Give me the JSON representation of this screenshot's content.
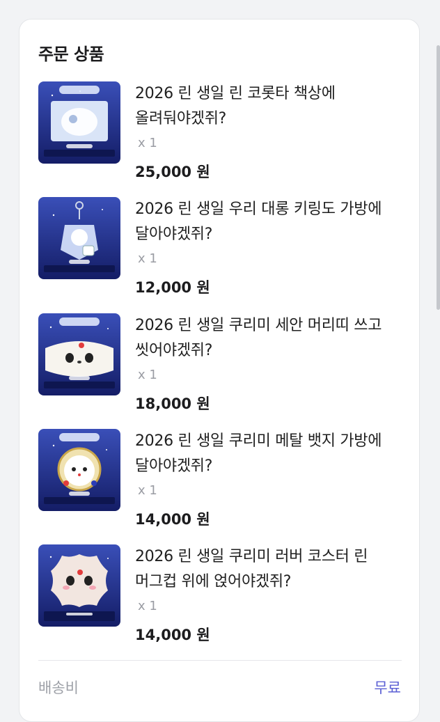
{
  "section": {
    "title": "주문 상품"
  },
  "items": [
    {
      "title_line1": "2026 린 생일 린 코롯타 책상에",
      "title_line2": "올려둬야겠쥐?",
      "qty": "x 1",
      "price": "25,000 원",
      "thumb_caption": "린 코롯타 책상에 올려둬야겠쥐"
    },
    {
      "title_line1": "2026 린 생일 우리 대롱 키링도 가방에",
      "title_line2": "달아야겠쥐?",
      "qty": "x 1",
      "price": "12,000 원",
      "thumb_caption": "우리 대롱 키링도 가방에 달아야겠쥐"
    },
    {
      "title_line1": "2026 린 생일 쿠리미 세안 머리띠 쓰고",
      "title_line2": "씻어야겠쥐?",
      "qty": "x 1",
      "price": "18,000 원",
      "thumb_caption": "쿠리미 세안 머리띠 쓰고 씻어야겠쥐"
    },
    {
      "title_line1": "2026 린 생일 쿠리미 메탈 뱃지 가방에",
      "title_line2": "달아야겠쥐?",
      "qty": "x 1",
      "price": "14,000 원",
      "thumb_caption": "쿠리미 메탈 뱃지 가방에 달아야겠쥐"
    },
    {
      "title_line1": "2026 린 생일 쿠리미 러버 코스터 린",
      "title_line2": "머그컵 위에 얹어야겠쥐?",
      "qty": "x 1",
      "price": "14,000 원",
      "thumb_caption": "린 머그컵 위에 얹어야겠쥐"
    }
  ],
  "shipping": {
    "label": "배송비",
    "value": "무료"
  },
  "colors": {
    "accent": "#5b5fd4",
    "thumb_bg": "#1b2a7a"
  }
}
